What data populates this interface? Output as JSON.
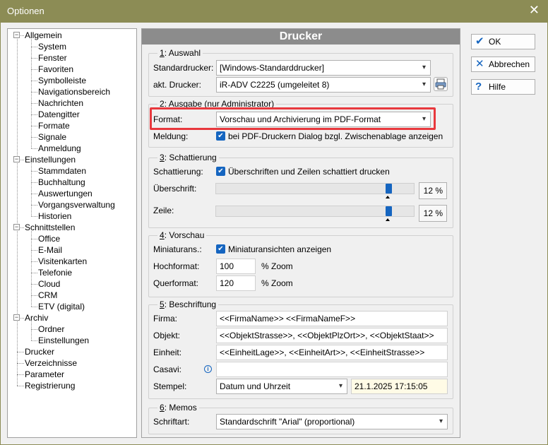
{
  "window": {
    "title": "Optionen"
  },
  "tree": {
    "items": [
      {
        "label": "Allgemein",
        "level": 0,
        "expander": "−"
      },
      {
        "label": "System",
        "level": 1
      },
      {
        "label": "Fenster",
        "level": 1
      },
      {
        "label": "Favoriten",
        "level": 1
      },
      {
        "label": "Symbolleiste",
        "level": 1
      },
      {
        "label": "Navigationsbereich",
        "level": 1
      },
      {
        "label": "Nachrichten",
        "level": 1
      },
      {
        "label": "Datengitter",
        "level": 1
      },
      {
        "label": "Formate",
        "level": 1
      },
      {
        "label": "Signale",
        "level": 1
      },
      {
        "label": "Anmeldung",
        "level": 1
      },
      {
        "label": "Einstellungen",
        "level": 0,
        "expander": "−"
      },
      {
        "label": "Stammdaten",
        "level": 1
      },
      {
        "label": "Buchhaltung",
        "level": 1
      },
      {
        "label": "Auswertungen",
        "level": 1
      },
      {
        "label": "Vorgangsverwaltung",
        "level": 1
      },
      {
        "label": "Historien",
        "level": 1
      },
      {
        "label": "Schnittstellen",
        "level": 0,
        "expander": "−"
      },
      {
        "label": "Office",
        "level": 1
      },
      {
        "label": "E-Mail",
        "level": 1
      },
      {
        "label": "Visitenkarten",
        "level": 1
      },
      {
        "label": "Telefonie",
        "level": 1
      },
      {
        "label": "Cloud",
        "level": 1
      },
      {
        "label": "CRM",
        "level": 1
      },
      {
        "label": "ETV (digital)",
        "level": 1
      },
      {
        "label": "Archiv",
        "level": 0,
        "expander": "−"
      },
      {
        "label": "Ordner",
        "level": 1
      },
      {
        "label": "Einstellungen",
        "level": 1
      },
      {
        "label": "Drucker",
        "level": 0
      },
      {
        "label": "Verzeichnisse",
        "level": 0
      },
      {
        "label": "Parameter",
        "level": 0
      },
      {
        "label": "Registrierung",
        "level": 0
      }
    ]
  },
  "panel": {
    "title": "Drucker",
    "auswahl": {
      "legend_u": "1",
      "legend_rest": ": Auswahl",
      "standarddrucker_label": "Standardrucker:",
      "standarddrucker_value": "[Windows-Standarddrucker]",
      "akt_label": "akt. Drucker:",
      "akt_value": "iR-ADV C2225 (umgeleitet 8)"
    },
    "ausgabe": {
      "legend_u": "2",
      "legend_rest": ": Ausgabe  (nur Administrator)",
      "format_label": "Format:",
      "format_value": "Vorschau und Archivierung im PDF-Format",
      "meldung_label": "Meldung:",
      "meldung_text": "bei PDF-Druckern Dialog bzgl. Zwischenablage anzeigen"
    },
    "schattierung": {
      "legend_u": "3",
      "legend_rest": ": Schattierung",
      "schattierung_label": "Schattierung:",
      "schattierung_text": "Überschriften und Zeilen schattiert drucken",
      "ueberschrift_label": "Überschrift:",
      "ueberschrift_pct": "12 %",
      "zeile_label": "Zeile:",
      "zeile_pct": "12 %"
    },
    "vorschau": {
      "legend_u": "4",
      "legend_rest": ": Vorschau",
      "miniatur_label": "Miniaturans.:",
      "miniatur_text": "Miniaturansichten anzeigen",
      "hoch_label": "Hochformat:",
      "hoch_value": "100",
      "hoch_unit": "% Zoom",
      "quer_label": "Querformat:",
      "quer_value": "120",
      "quer_unit": "% Zoom"
    },
    "beschriftung": {
      "legend_u": "5",
      "legend_rest": ": Beschriftung",
      "firma_label": "Firma:",
      "firma_value": "<<FirmaName>> <<FirmaNameF>>",
      "objekt_label": "Objekt:",
      "objekt_value": "<<ObjektStrasse>>, <<ObjektPlzOrt>>, <<ObjektStaat>>",
      "einheit_label": "Einheit:",
      "einheit_value": "<<EinheitLage>>, <<EinheitArt>>, <<EinheitStrasse>>",
      "casavi_label": "Casavi:",
      "casavi_value": "",
      "stempel_label": "Stempel:",
      "stempel_value": "Datum und Uhrzeit",
      "stempel_preview": "21.1.2025 17:15:05"
    },
    "memos": {
      "legend_u": "6",
      "legend_rest": ": Memos",
      "schriftart_label": "Schriftart:",
      "schriftart_value": "Standardschrift \"Arial\" (proportional)"
    }
  },
  "buttons": {
    "ok": "OK",
    "abbrechen": "Abbrechen",
    "hilfe": "Hilfe"
  },
  "colors": {
    "titlebar": "#8c8c55",
    "panel_header": "#8c8c8c",
    "accent": "#1565c0",
    "highlight": "#e8383d",
    "stamp_bg": "#fffbe6"
  }
}
